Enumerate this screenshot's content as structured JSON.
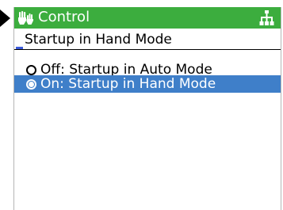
{
  "header": {
    "title": "Control",
    "icon": "hand-control-icon",
    "right_icon": "network-icon",
    "color": "#3cad3e"
  },
  "subtitle": "Startup in Hand Mode",
  "options": [
    {
      "label": "Off: Startup in Auto Mode",
      "selected": false
    },
    {
      "label": "On: Startup in Hand Mode",
      "selected": true
    }
  ],
  "colors": {
    "selection": "#3f7fc9",
    "cursor": "#3b5bdb"
  }
}
